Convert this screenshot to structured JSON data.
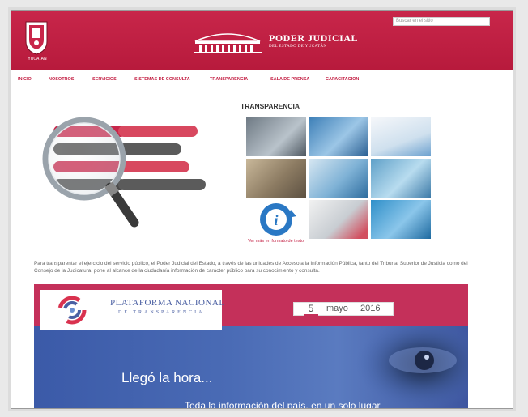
{
  "header": {
    "search_placeholder": "Buscar en el sitio",
    "crest_label": "YUCATAN",
    "title": "PODER JUDICIAL",
    "subtitle": "DEL ESTADO DE YUCATÁN"
  },
  "nav": {
    "items": [
      {
        "label": "INICIO"
      },
      {
        "label": "NOSOTROS"
      },
      {
        "label": "SERVICIOS"
      },
      {
        "label": "SISTEMAS DE CONSULTA"
      },
      {
        "label": "TRANSPARENCIA"
      },
      {
        "label": "SALA DE PRENSA"
      },
      {
        "label": "CAPACITACION"
      }
    ]
  },
  "main": {
    "section_title": "TRANSPARENCIA",
    "magnifier_labels": [
      "",
      "",
      "",
      "",
      "",
      "",
      "",
      ""
    ],
    "ver_mas": "Ver más en formato de texto",
    "paragraph": "Para transparentar el ejercicio del servicio público, el Poder Judicial del Estado, a través de las unidades de Acceso a la Información Pública, tanto del Tribunal Superior de Justicia como del Consejo de la Judicatura, pone al alcance de la ciudadanía información de carácter público para su conocimiento y consulta."
  },
  "banner": {
    "platform_title": "PLATAFORMA NACIONAL",
    "platform_subtitle": "DE TRANSPARENCIA",
    "platform_url": "",
    "date_day": "5",
    "date_month": "mayo",
    "date_year": "2016",
    "headline": "Llegó la hora...",
    "tagline": "Toda la información del país, en un solo lugar"
  },
  "colors": {
    "brand_red": "#c31e42",
    "banner_pink": "#c4305a",
    "banner_blue": "#3b5aa8"
  }
}
